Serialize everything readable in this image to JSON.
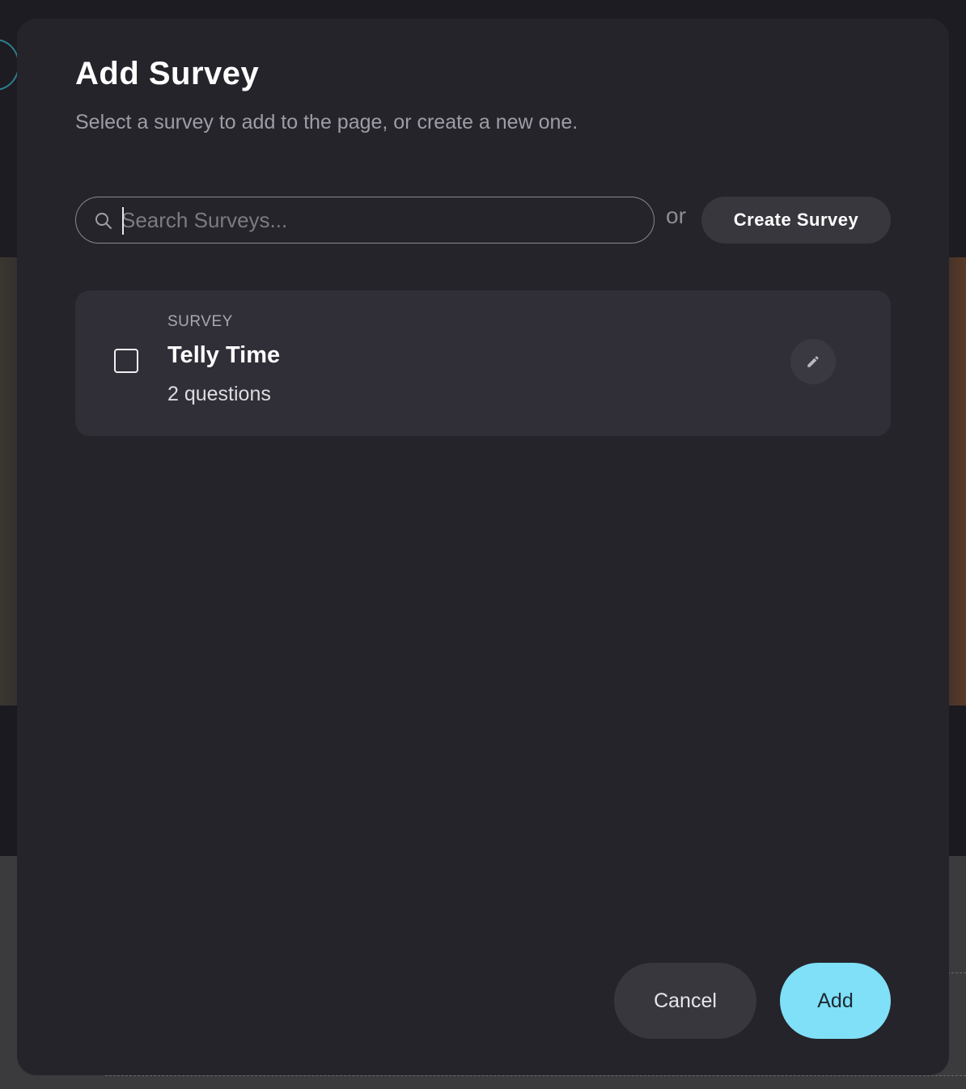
{
  "modal": {
    "title": "Add Survey",
    "subtitle": "Select a survey to add to the page, or create a new one."
  },
  "search": {
    "placeholder": "Search Surveys...",
    "value": "",
    "icon": "search-icon"
  },
  "separator_text": "or",
  "create_button": {
    "label": "Create Survey"
  },
  "surveys": [
    {
      "type_label": "SURVEY",
      "name": "Telly Time",
      "question_count_text": "2 questions",
      "checked": false,
      "edit_icon": "pencil-icon"
    }
  ],
  "footer": {
    "cancel_label": "Cancel",
    "add_label": "Add"
  },
  "colors": {
    "modal_background": "#25242b",
    "card_background": "#302f38",
    "accent": "#7fe0f8",
    "secondary_button": "#38373e"
  }
}
